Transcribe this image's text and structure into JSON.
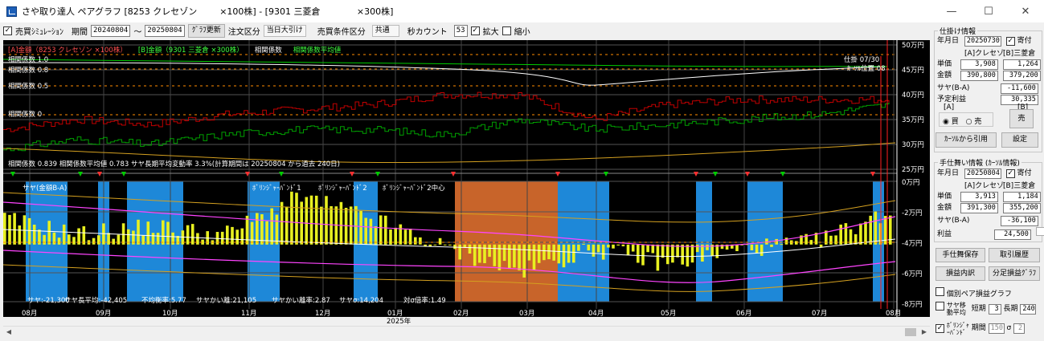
{
  "window": {
    "title": "さや取り達人 ペアグラフ [8253 クレセゾン        ×100株] - [9301 三菱倉             ×300株]",
    "minimize": "—",
    "maximize": "☐",
    "close": "✕"
  },
  "toolbar": {
    "sim_checkbox": "✓",
    "sim_label": "売買ｼﾐｭﾚｰｼｮﾝ",
    "period_label": "期間",
    "date_from": "20240804",
    "tilde": "〜",
    "date_to": "20250804",
    "update_button": "ｸﾞﾗﾌ更新",
    "order_label": "注文区分",
    "order_value": "当日大引け",
    "cond_label": "売買条件区分",
    "cond_value": "共通",
    "seconds_label": "秒カウント",
    "seconds_value": "53",
    "zoom_in_checkbox": "✓",
    "zoom_in_label": "拡大",
    "zoom_out_label": "縮小"
  },
  "chart": {
    "upper_legend": [
      "[A]金額（8253 クレセゾン     ×100株）",
      "[B]金額（9301 三菱倉       ×300株）",
      "相関係数",
      "相関係数平均値"
    ],
    "corr_labels": [
      "相関係数 1.0",
      "相関係数 0.8",
      "相関係数 0.5",
      "相関係数 0"
    ],
    "right_axis_upper": [
      "50万円",
      "45万円",
      "40万円",
      "35万円",
      "30万円",
      "25万円"
    ],
    "right_axis_lower": [
      "0万円",
      "-2万円",
      "-4万円",
      "-6万円",
      "-8万円"
    ],
    "stat_line": "相関係数 0.839  相関係数平均値 0.783 サヤ長期平均変動率 3.3%(計算期間は 20250804 から過去 240日)",
    "shikake_label": "仕掛 07/30",
    "cursor_label": "ｶｰｿﾙ位置 08",
    "lower_legend": [
      "サヤ(金額B-A)",
      "ﾎﾞﾘﾝｼﾞｬｰﾊﾞﾝﾄﾞ1",
      "ﾎﾞﾘﾝｼﾞｬｰﾊﾞﾝﾄﾞ2",
      "ﾎﾞﾘﾝｼﾞｬｰﾊﾞﾝﾄﾞ2中心"
    ],
    "stats": [
      "サヤ:-21,300",
      "サヤ長平均:-42,405",
      "不均衡率:5.77",
      "サヤかい離:21,105",
      "サヤかい離率:2.87",
      "サヤσ:14,204",
      "対σ倍率:1.49"
    ],
    "months": [
      "08月",
      "09月",
      "10月",
      "11月",
      "12月",
      "01月",
      "02月",
      "03月",
      "04月",
      "05月",
      "06月",
      "07月",
      "08月"
    ],
    "year": "2025年",
    "colors": {
      "a_line": "#c00000",
      "b_line": "#00a000",
      "corr": "#ffffff",
      "corr_avg": "#00cc00",
      "spread": "#e8f020",
      "band1": "#ff44ff",
      "band2": "#d4a020",
      "center": "#ffffff",
      "blue_zone": "#1e88d8",
      "orange_zone": "#c8642a"
    }
  },
  "chart_data": {
    "type": "line",
    "x": [
      "2024-08",
      "2024-09",
      "2024-10",
      "2024-11",
      "2024-12",
      "2025-01",
      "2025-02",
      "2025-03",
      "2025-04",
      "2025-05",
      "2025-06",
      "2025-07",
      "2025-08"
    ],
    "series": [
      {
        "name": "[A]金額（8253 クレセゾン ×100株）",
        "values": [
          33,
          35,
          34,
          36,
          37,
          38,
          40,
          40,
          35,
          38,
          39,
          39,
          39
        ]
      },
      {
        "name": "[B]金額（9301 三菱倉 ×300株）",
        "values": [
          29,
          31,
          30,
          32,
          33,
          33,
          32,
          35,
          33,
          34,
          35,
          36,
          38
        ]
      },
      {
        "name": "サヤ(金額B-A)",
        "values": [
          -2.5,
          -3.5,
          -3,
          -3.5,
          -1,
          -2.5,
          -4.5,
          -6,
          -4.5,
          -5.5,
          -4.5,
          -4,
          -2
        ]
      }
    ],
    "ylabel_upper": "万円",
    "ylim_upper": [
      25,
      50
    ],
    "ylim_lower": [
      -8,
      0
    ]
  },
  "panel": {
    "shikake_title": "仕掛け情報",
    "date_label": "年月日",
    "shikake_date": "20250730",
    "yoriyori_check": "✓",
    "yoriyori_label": "寄付",
    "col_a": "[A]クレセゾ",
    "col_b": "[B]三菱倉",
    "unit_label": "単価",
    "unit_a": "3,908",
    "unit_b": "1,264",
    "amount_label": "金額",
    "amount_a": "390,800",
    "amount_b": "379,200",
    "saya_label": "サヤ(B-A)",
    "saya_value": "-11,600",
    "profit_label": "予定利益",
    "profit_value": "30,335",
    "a_label": "[A]",
    "b_label": "[B]",
    "buy_label": "買",
    "sell_label": "売",
    "b_sell_button": "売",
    "cursor_cite_button": "ｶｰｿﾙから引用",
    "settings_button": "設定",
    "close_title": "手仕舞い情報 (ｶｰｿﾙ情報)",
    "close_date": "20250804",
    "close_yori_check": "✓",
    "close_yori_label": "寄付",
    "c_unit_a": "3,913",
    "c_unit_b": "1,184",
    "c_amount_a": "391,300",
    "c_amount_b": "355,200",
    "c_saya": "-36,100",
    "c_profit_label": "利益",
    "c_profit": "24,500",
    "c_kehai_label": "気配",
    "save_button": "手仕舞保存",
    "history_button": "取引履歴",
    "breakdown_button": "損益内訳",
    "ratio_button": "分足損益ｸﾞﾗﾌ",
    "pair_label": "個別ペア損益グラフ",
    "sma_label": "サヤ移動平均",
    "short_label": "短期",
    "short_value": "3",
    "long_label": "長期",
    "long_value": "240",
    "boll_check": "✓",
    "boll_label": "ﾎﾞﾘﾝｼﾞｬｰﾊﾞﾝﾄﾞ",
    "period_label": "期間",
    "period_value": "150",
    "sigma_label": "σ",
    "sigma_value": "2"
  }
}
